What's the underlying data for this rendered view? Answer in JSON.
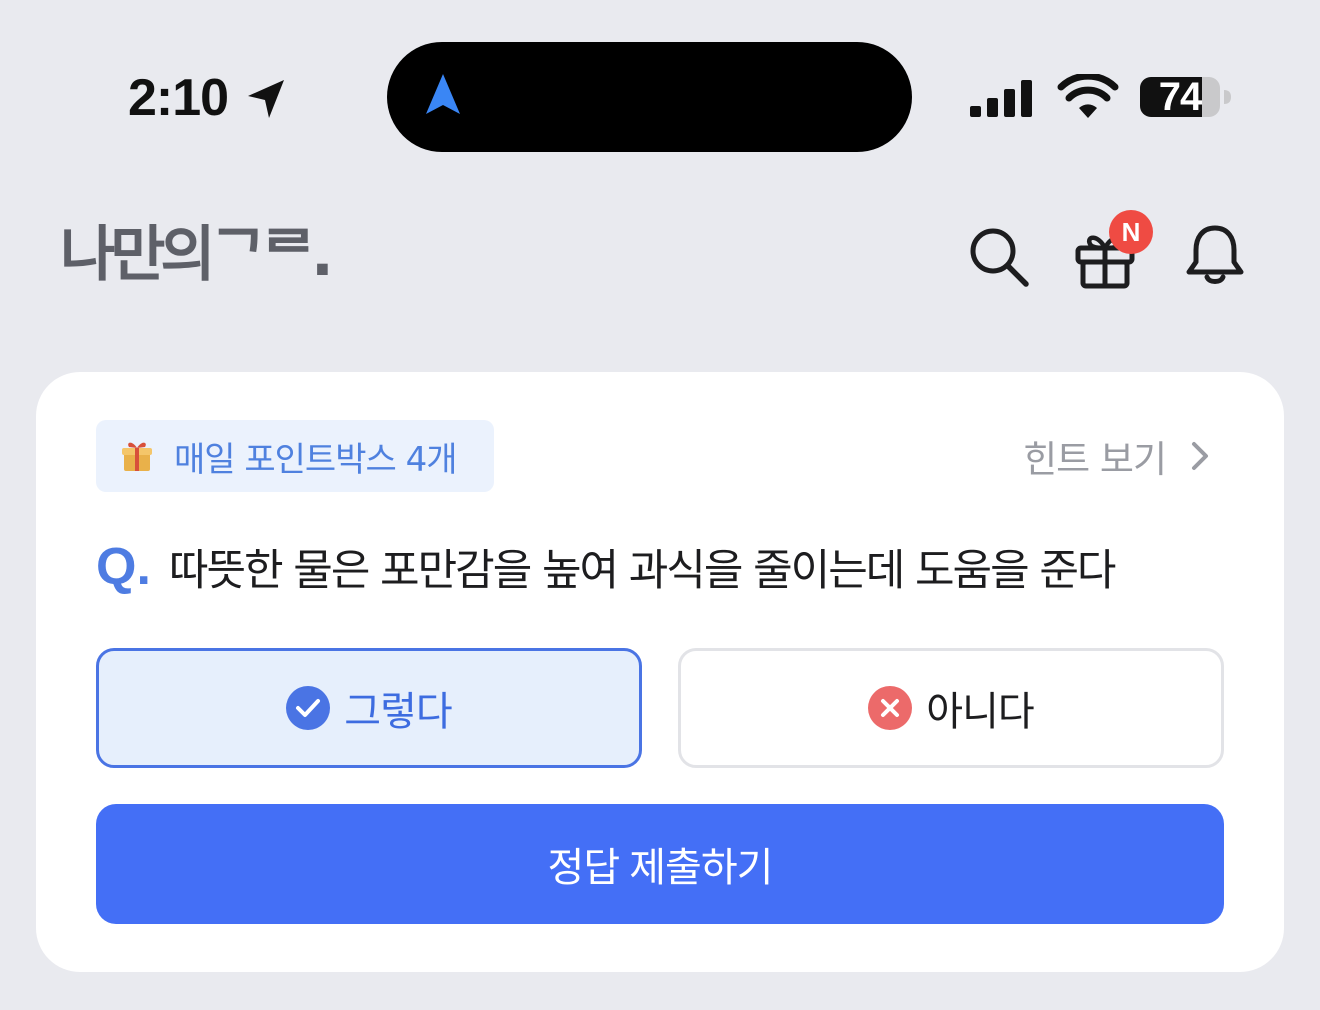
{
  "status_bar": {
    "time": "2:10",
    "battery_level": "74",
    "icons": [
      "location-arrow-icon",
      "navigation-arrow-icon",
      "cellular-signal-icon",
      "wifi-icon",
      "battery-icon"
    ]
  },
  "header": {
    "logo_text": "나만의ᄀᄅ.",
    "icons": [
      "search-icon",
      "gift-icon",
      "bell-icon"
    ],
    "gift_badge": "N"
  },
  "quiz": {
    "points_chip": "매일 포인트박스 4개",
    "hint_label": "힌트 보기",
    "question_marker": "Q.",
    "question_text": "따뜻한 물은 포만감을 높여 과식을 줄이는데 도움을 준다",
    "options": [
      {
        "label": "그렇다",
        "icon": "check-circle-icon",
        "selected": true
      },
      {
        "label": "아니다",
        "icon": "x-circle-icon",
        "selected": false
      }
    ],
    "submit_label": "정답 제출하기"
  },
  "colors": {
    "background": "#e9eaef",
    "accent": "#446ff6",
    "selected_border": "#4a74e4",
    "badge": "#ef4b43",
    "wrong_icon": "#ec6a6a"
  }
}
